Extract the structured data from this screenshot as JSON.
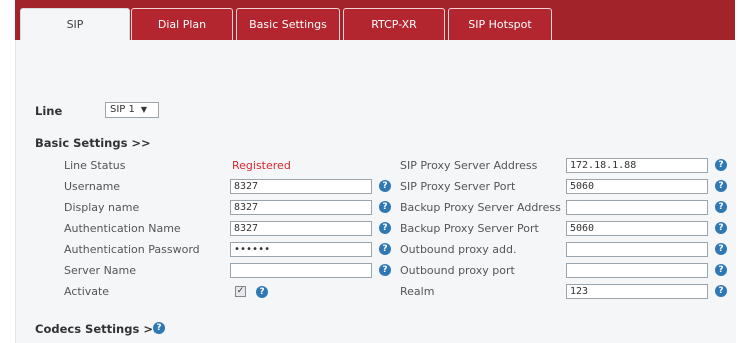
{
  "tabs": [
    "SIP",
    "Dial Plan",
    "Basic Settings",
    "RTCP-XR",
    "SIP Hotspot"
  ],
  "line": {
    "label": "Line",
    "value": "SIP 1"
  },
  "basic_settings_title": "Basic Settings >>",
  "codecs_settings_title": "Codecs Settings >>",
  "left": {
    "line_status": {
      "label": "Line Status",
      "value": "Registered"
    },
    "username": {
      "label": "Username",
      "value": "8327"
    },
    "display_name": {
      "label": "Display name",
      "value": "8327"
    },
    "auth_name": {
      "label": "Authentication Name",
      "value": "8327"
    },
    "auth_password": {
      "label": "Authentication Password",
      "value": "••••••"
    },
    "server_name": {
      "label": "Server Name",
      "value": ""
    },
    "activate": {
      "label": "Activate",
      "checked": true,
      "mark": "✓"
    }
  },
  "right": {
    "proxy_address": {
      "label": "SIP Proxy Server Address",
      "value": "172.18.1.88"
    },
    "proxy_port": {
      "label": "SIP Proxy Server Port",
      "value": "5060"
    },
    "backup_address": {
      "label": "Backup Proxy Server Address",
      "value": ""
    },
    "backup_port": {
      "label": "Backup Proxy Server Port",
      "value": "5060"
    },
    "outbound_add": {
      "label": "Outbound proxy add.",
      "value": ""
    },
    "outbound_port": {
      "label": "Outbound proxy port",
      "value": ""
    },
    "realm": {
      "label": "Realm",
      "value": "123"
    }
  },
  "help_glyph": "?",
  "caret_glyph": "▼"
}
